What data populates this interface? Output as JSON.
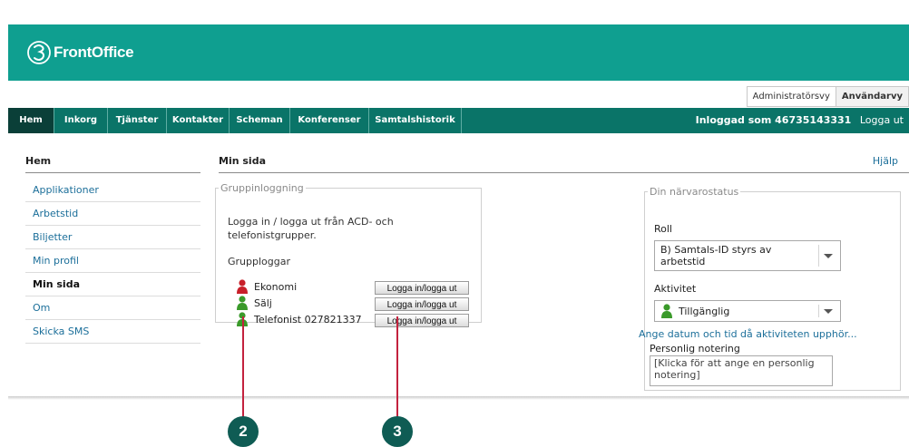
{
  "brand": {
    "logo_text": "FrontOffice"
  },
  "view_switch": {
    "admin_label": "Administratörsvy",
    "user_label": "Användarvy"
  },
  "nav": {
    "items": [
      {
        "label": "Hem",
        "active": true
      },
      {
        "label": "Inkorg"
      },
      {
        "label": "Tjänster"
      },
      {
        "label": "Kontakter"
      },
      {
        "label": "Scheman"
      },
      {
        "label": "Konferenser"
      },
      {
        "label": "Samtalshistorik"
      }
    ],
    "logged_in_text": "Inloggad som 46735143331",
    "logout_label": "Logga ut"
  },
  "sidebar": {
    "title": "Hem",
    "items": [
      {
        "label": "Applikationer"
      },
      {
        "label": "Arbetstid"
      },
      {
        "label": "Biljetter"
      },
      {
        "label": "Min profil"
      },
      {
        "label": "Min sida",
        "active": true
      },
      {
        "label": "Om"
      },
      {
        "label": "Skicka SMS"
      }
    ]
  },
  "main": {
    "title": "Min sida",
    "help_label": "Hjälp",
    "group_panel": {
      "legend": "Gruppinloggning",
      "description": "Logga in / logga ut från ACD- och telefonistgrupper.",
      "subheading": "Grupploggar",
      "groups": [
        {
          "name": "Ekonomi",
          "status_color": "#c8202a",
          "button_label": "Logga in/logga ut"
        },
        {
          "name": "Sälj",
          "status_color": "#3a9a2a",
          "button_label": "Logga in/logga ut"
        },
        {
          "name": "Telefonist 027821337",
          "status_color": "#3a9a2a",
          "button_label": "Logga in/logga ut"
        }
      ]
    },
    "status_panel": {
      "legend": "Din närvarostatus",
      "role_label": "Roll",
      "role_value": "B) Samtals-ID styrs av arbetstid",
      "activity_label": "Aktivitet",
      "activity_value": "Tillgänglig",
      "activity_color": "#3a9a2a",
      "schedule_link": "Ange datum och tid då aktiviteten upphör...",
      "note_label": "Personlig notering",
      "note_placeholder": "[Klicka för att ange en personlig notering]"
    }
  },
  "callouts": [
    "2",
    "3"
  ],
  "colors": {
    "brand_teal": "#0f9f90",
    "nav_dark": "#0a7468",
    "callout_line": "#c3223e",
    "link": "#1c6f9a"
  }
}
